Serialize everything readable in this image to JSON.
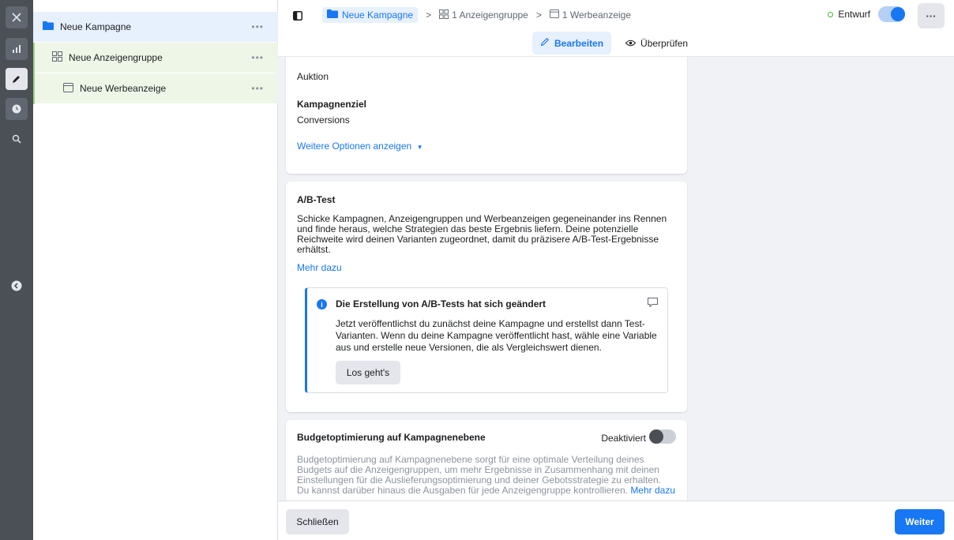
{
  "rail": {
    "items": [
      "close-icon",
      "chart-icon",
      "pencil-icon",
      "clock-icon",
      "search-icon",
      "collapse-icon"
    ]
  },
  "tree": {
    "campaign": "Neue Kampagne",
    "adset": "Neue Anzeigengruppe",
    "ad": "Neue Werbeanzeige",
    "more": "•••"
  },
  "header": {
    "crumb_campaign": "Neue Kampagne",
    "crumb_adsets": "1 Anzeigengruppe",
    "crumb_ads": "1 Werbeanzeige",
    "separator": ">",
    "status_label": "Entwurf",
    "more": "···",
    "tab_edit": "Bearbeiten",
    "tab_review": "Überprüfen"
  },
  "main": {
    "auction_value": "Auktion",
    "objective_label": "Kampagnenziel",
    "objective_value": "Conversions",
    "more_options": "Weitere Optionen anzeigen",
    "abtest": {
      "title": "A/B-Test",
      "description_lines": [
        "Schicke Kampagnen, Anzeigengruppen und Werbeanzeigen gegeneinander ins Rennen",
        "und finde heraus, welche Strategien das beste Ergebnis liefern. Deine potenzielle",
        "Reichweite wird deinen Varianten zugeordnet, damit du präzisere A/B-Test-Ergebnisse",
        "erhältst."
      ],
      "learn_more": "Mehr dazu",
      "info_title": "Die Erstellung von A/B-Tests hat sich geändert",
      "info_lines": [
        "Jetzt veröffentlichst du zunächst deine Kampagne und erstellst dann Test-",
        "Varianten. Wenn du deine Kampagne veröffentlicht hast, wähle eine Variable",
        "aus und erstelle neue Versionen, die als Vergleichswert dienen."
      ],
      "info_button": "Los geht's"
    },
    "budget": {
      "title": "Budgetoptimierung auf Kampagnenebene",
      "toggle_label": "Deaktiviert",
      "description_lines": [
        "Budgetoptimierung auf Kampagnenebene sorgt für eine optimale Verteilung deines",
        "Budgets auf die Anzeigengruppen, um mehr Ergebnisse in Zusammenhang mit deinen",
        "Einstellungen für die Auslieferungsoptimierung und deiner Gebotsstrategie zu erhalten.",
        "Du kannst darüber hinaus die Ausgaben für jede Anzeigengruppe kontrollieren."
      ],
      "learn_more": "Mehr dazu"
    }
  },
  "footer": {
    "close": "Schließen",
    "next": "Weiter"
  },
  "colors": {
    "accent": "#1877f2",
    "rail": "#4b4f56",
    "status_green": "#42b72a"
  }
}
